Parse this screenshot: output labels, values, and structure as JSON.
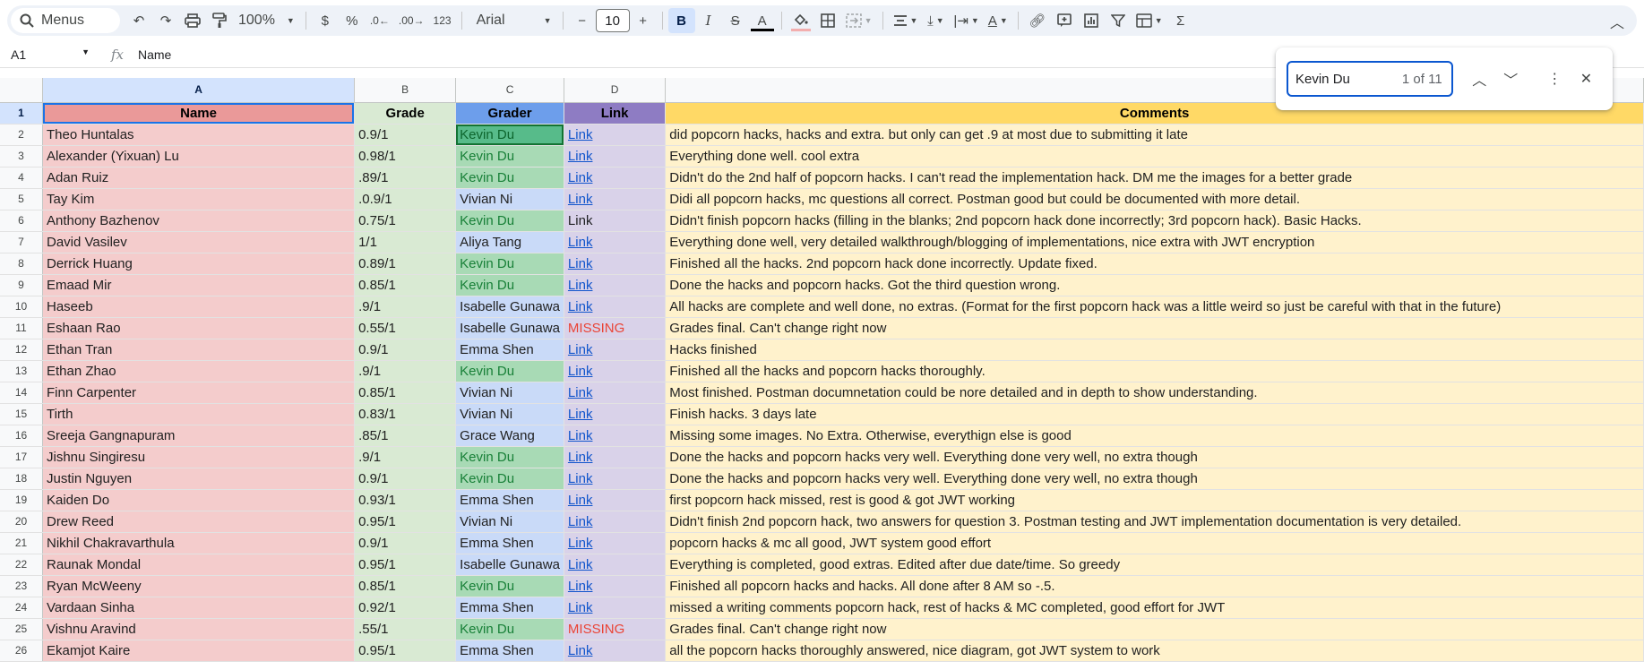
{
  "toolbar": {
    "menus_label": "Menus",
    "zoom": "100%",
    "currency": "$",
    "percent": "%",
    "dec_decrease": ".0",
    "dec_increase": ".00",
    "number_format": "123",
    "font_family": "Arial",
    "font_size": "10",
    "minus": "−",
    "plus": "+",
    "bold": "B",
    "italic": "I",
    "strike": "S",
    "text_color": "A",
    "sigma": "Σ"
  },
  "formula_bar": {
    "cell_ref": "A1",
    "fx": "fx",
    "content": "Name"
  },
  "find": {
    "query": "Kevin Du",
    "count": "1 of 11"
  },
  "columns": [
    "A",
    "B",
    "C",
    "D",
    ""
  ],
  "header": {
    "name": "Name",
    "grade": "Grade",
    "grader": "Grader",
    "link": "Link",
    "comments": "Comments"
  },
  "rows": [
    {
      "num": "2",
      "name": "Theo Huntalas",
      "grade": "0.9/1",
      "grader": "Kevin Du",
      "link": "Link",
      "comment": "did popcorn hacks, hacks and extra. but only can get .9 at most due to submitting it late"
    },
    {
      "num": "3",
      "name": "Alexander (Yixuan) Lu",
      "grade": "0.98/1",
      "grader": "Kevin Du",
      "link": "Link",
      "comment": "Everything done well. cool extra"
    },
    {
      "num": "4",
      "name": "Adan Ruiz",
      "grade": ".89/1",
      "grader": "Kevin Du",
      "link": "Link",
      "comment": "Didn't do the 2nd half of popcorn hacks. I can't read the implementation hack. DM me the images for a better grade"
    },
    {
      "num": "5",
      "name": "Tay Kim",
      "grade": ".0.9/1",
      "grader": "Vivian Ni",
      "link": "Link",
      "comment": "Didi all popcorn hacks, mc questions all correct. Postman good but could be documented with more detail."
    },
    {
      "num": "6",
      "name": "Anthony Bazhenov",
      "grade": "0.75/1",
      "grader": "Kevin Du",
      "link": "Link",
      "comment": "Didn't finish popcorn hacks (filling in the blanks; 2nd popcorn hack done incorrectly; 3rd popcorn hack). Basic Hacks."
    },
    {
      "num": "7",
      "name": "David Vasilev",
      "grade": "1/1",
      "grader": "Aliya Tang",
      "link": "Link",
      "comment": "Everything done well, very detailed walkthrough/blogging of implementations, nice extra with JWT encryption"
    },
    {
      "num": "8",
      "name": "Derrick Huang",
      "grade": "0.89/1",
      "grader": "Kevin Du",
      "link": "Link",
      "comment": "Finished all the hacks. 2nd popcorn hack done incorrectly. Update fixed."
    },
    {
      "num": "9",
      "name": "Emaad Mir",
      "grade": "0.85/1",
      "grader": "Kevin Du",
      "link": "Link",
      "comment": "Done the hacks and popcorn hacks. Got the third question wrong."
    },
    {
      "num": "10",
      "name": "Haseeb",
      "grade": ".9/1",
      "grader": "Isabelle Gunawa",
      "link": "Link",
      "comment": "All hacks are complete and well done, no extras. (Format for the first popcorn hack was a little weird so just be careful with that in the future)"
    },
    {
      "num": "11",
      "name": "Eshaan Rao",
      "grade": "0.55/1",
      "grader": "Isabelle Gunawa",
      "link": "MISSING",
      "comment": "Grades final. Can't change right now"
    },
    {
      "num": "12",
      "name": "Ethan Tran",
      "grade": "0.9/1",
      "grader": "Emma Shen",
      "link": "Link",
      "comment": "Hacks finished"
    },
    {
      "num": "13",
      "name": "Ethan Zhao",
      "grade": ".9/1",
      "grader": "Kevin Du",
      "link": "Link",
      "comment": "Finished all the hacks and popcorn hacks thoroughly."
    },
    {
      "num": "14",
      "name": "Finn Carpenter",
      "grade": "0.85/1",
      "grader": "Vivian Ni",
      "link": "Link",
      "comment": "Most finished. Postman documnetation could be nore detailed and in depth to show understanding."
    },
    {
      "num": "15",
      "name": "Tirth",
      "grade": "0.83/1",
      "grader": "Vivian Ni",
      "link": "Link",
      "comment": "Finish hacks. 3 days late"
    },
    {
      "num": "16",
      "name": "Sreeja Gangnapuram",
      "grade": ".85/1",
      "grader": "Grace Wang",
      "link": "Link",
      "comment": "Missing some images. No Extra. Otherwise, everythign else is good"
    },
    {
      "num": "17",
      "name": "Jishnu Singiresu",
      "grade": ".9/1",
      "grader": "Kevin Du",
      "link": "Link",
      "comment": "Done the hacks and popcorn hacks very well.  Everything done very well, no extra though"
    },
    {
      "num": "18",
      "name": "Justin Nguyen",
      "grade": "0.9/1",
      "grader": "Kevin Du",
      "link": "Link",
      "comment": "Done the hacks and popcorn hacks very well.  Everything done very well, no extra though"
    },
    {
      "num": "19",
      "name": "Kaiden Do",
      "grade": "0.93/1",
      "grader": "Emma Shen",
      "link": "Link",
      "comment": "first popcorn hack missed, rest is good & got JWT working"
    },
    {
      "num": "20",
      "name": "Drew Reed",
      "grade": "0.95/1",
      "grader": "Vivian Ni",
      "link": "Link",
      "comment": "Didn't finish 2nd popcorn hack, two answers for question 3. Postman testing and JWT implementation documentation is very detailed."
    },
    {
      "num": "21",
      "name": "Nikhil Chakravarthula",
      "grade": "0.9/1",
      "grader": "Emma Shen",
      "link": "Link",
      "comment": "popcorn hacks & mc all good, JWT system good effort"
    },
    {
      "num": "22",
      "name": "Raunak Mondal",
      "grade": "0.95/1",
      "grader": "Isabelle Gunawa",
      "link": "Link",
      "comment": "Everything is completed, good extras. Edited after due date/time. So greedy"
    },
    {
      "num": "23",
      "name": "Ryan McWeeny",
      "grade": "0.85/1",
      "grader": "Kevin Du",
      "link": "Link",
      "comment": "Finished all popcorn hacks and hacks. All done after 8 AM so -.5."
    },
    {
      "num": "24",
      "name": "Vardaan Sinha",
      "grade": "0.92/1",
      "grader": "Emma Shen",
      "link": "Link",
      "comment": "missed a writing comments popcorn hack, rest of hacks & MC completed, good effort for JWT"
    },
    {
      "num": "25",
      "name": "Vishnu Aravind",
      "grade": ".55/1",
      "grader": "Kevin Du",
      "link": "MISSING",
      "comment": "Grades final. Can't change right now"
    },
    {
      "num": "26",
      "name": "Ekamjot Kaire",
      "grade": "0.95/1",
      "grader": "Emma Shen",
      "link": "Link",
      "comment": "all the popcorn hacks thoroughly answered, nice diagram, got JWT system to work"
    }
  ],
  "colors": {
    "name_fill": "#f4cccc",
    "grade_fill": "#d9ead3",
    "grader_fill": "#c9daf8",
    "link_fill": "#d9d2e9",
    "comment_fill": "#fff2cc",
    "match_highlight": "#a8dab5",
    "link_text": "#1155cc",
    "missing_text": "#ea4335"
  }
}
